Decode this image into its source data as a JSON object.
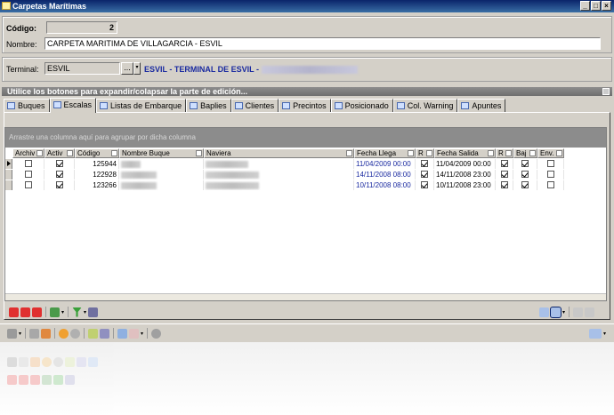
{
  "window": {
    "title": "Carpetas Marítimas",
    "buttons": [
      "_",
      "□",
      "×"
    ]
  },
  "header": {
    "codigo_label": "Código:",
    "codigo_value": "2",
    "nombre_label": "Nombre:",
    "nombre_value": "CARPETA MARITIMA DE VILLAGARCIA - ESVIL",
    "terminal_label": "Terminal:",
    "terminal_value": "ESVIL",
    "terminal_button": "...",
    "terminal_description": "ESVIL - TERMINAL DE ESVIL -"
  },
  "expand_bar": {
    "text": "Utilice los botones para expandir/colapsar la parte de edición..."
  },
  "tabs": [
    {
      "label": "Buques",
      "active": false
    },
    {
      "label": "Escalas",
      "active": true
    },
    {
      "label": "Listas de Embarque",
      "active": false
    },
    {
      "label": "Baplies",
      "active": false
    },
    {
      "label": "Clientes",
      "active": false
    },
    {
      "label": "Precintos",
      "active": false
    },
    {
      "label": "Posicionado",
      "active": false
    },
    {
      "label": "Col. Warning",
      "active": false
    },
    {
      "label": "Apuntes",
      "active": false
    }
  ],
  "grid": {
    "group_hint": "Arrastre una columna aquí para agrupar por dicha columna",
    "columns": [
      "Archiv",
      "Activ",
      "Código",
      "Nombre Buque",
      "Naviera",
      "Fecha Llega",
      "R",
      "Fecha Salida",
      "R",
      "Baj",
      "Env."
    ],
    "rows": [
      {
        "archiv": false,
        "activ": true,
        "codigo": "125944",
        "fecha_llegada": "11/04/2009 00:00",
        "r1": true,
        "fecha_salida": "11/04/2009 00:00",
        "r2": true,
        "baj": true,
        "env": false
      },
      {
        "archiv": false,
        "activ": true,
        "codigo": "122928",
        "fecha_llegada": "14/11/2008 08:00",
        "r1": true,
        "fecha_salida": "14/11/2008 23:00",
        "r2": true,
        "baj": true,
        "env": false
      },
      {
        "archiv": false,
        "activ": true,
        "codigo": "123266",
        "fecha_llegada": "10/11/2008 08:00",
        "r1": true,
        "fecha_salida": "10/11/2008 23:00",
        "r2": true,
        "baj": true,
        "env": false
      }
    ]
  },
  "colors": {
    "title_start": "#0a246a",
    "title_end": "#3a6ea5",
    "link_blue": "#1a2aa0",
    "face": "#d4d0c8"
  }
}
